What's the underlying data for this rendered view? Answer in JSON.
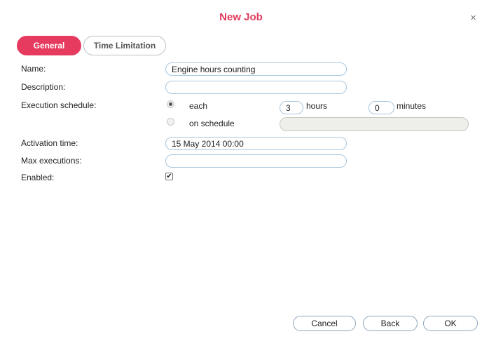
{
  "dialog": {
    "title": "New Job",
    "close_glyph": "×"
  },
  "tabs": [
    {
      "label": "General",
      "active": true
    },
    {
      "label": "Time Limitation",
      "active": false
    }
  ],
  "form": {
    "name": {
      "label": "Name:",
      "value": "Engine hours counting"
    },
    "description": {
      "label": "Description:",
      "value": ""
    },
    "execution_schedule": {
      "label": "Execution schedule:",
      "each": {
        "label": "each",
        "selected": true,
        "hours_value": "3",
        "hours_label": "hours",
        "minutes_value": "0",
        "minutes_label": "minutes"
      },
      "on_schedule": {
        "label": "on schedule",
        "selected": false,
        "value": ""
      }
    },
    "activation_time": {
      "label": "Activation time:",
      "value": "15 May 2014 00:00"
    },
    "max_executions": {
      "label": "Max executions:",
      "value": ""
    },
    "enabled": {
      "label": "Enabled:",
      "checked": true,
      "check_glyph": "✔"
    }
  },
  "buttons": {
    "cancel": "Cancel",
    "back": "Back",
    "ok": "OK"
  }
}
